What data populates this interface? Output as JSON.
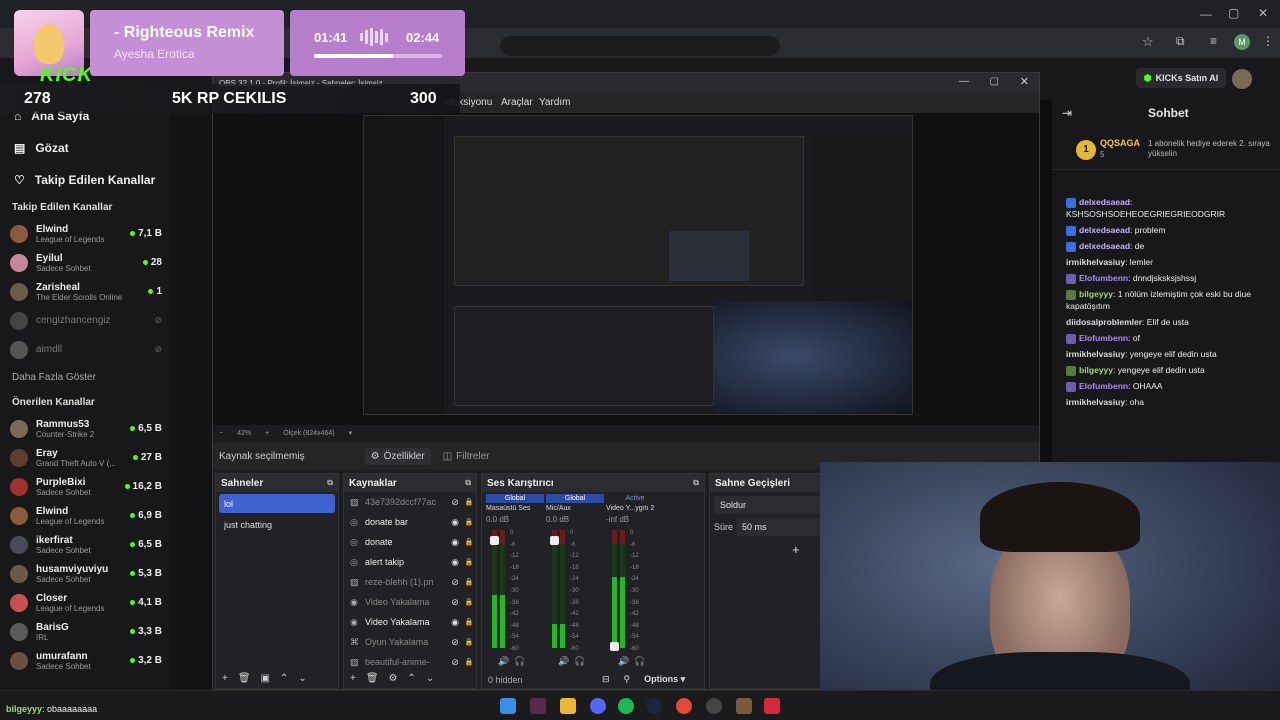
{
  "overlay": {
    "song_title": "- Righteous Remix",
    "artist": "Ayesha Erotica",
    "time_current": "01:41",
    "time_total": "02:44",
    "kick_logo": "KICK",
    "stats": {
      "left_num": "278",
      "center": "5K RP CEKILIS",
      "right_num": "300"
    }
  },
  "browser": {
    "kick_button": "KICKs Satın Al"
  },
  "sidebar": {
    "nav": [
      {
        "label": "Ana Sayfa",
        "icon": "home-icon"
      },
      {
        "label": "Gözat",
        "icon": "browse-icon"
      },
      {
        "label": "Takip Edilen Kanallar",
        "icon": "heart-icon"
      }
    ],
    "followed_heading": "Takip Edilen Kanallar",
    "followed": [
      {
        "name": "Elwind",
        "category": "League of Legends",
        "viewers": "7,1 B",
        "color": "#8a5a3c"
      },
      {
        "name": "Eyilul",
        "category": "Sadece Sohbet",
        "viewers": "28",
        "color": "#c4889a"
      },
      {
        "name": "Zarisheal",
        "category": "The Elder Scrolls Online",
        "viewers": "1",
        "color": "#6b5b4b"
      },
      {
        "name": "cengizhancengiz",
        "category": "",
        "viewers": "",
        "color": "#444",
        "offline": true
      },
      {
        "name": "aimdll",
        "category": "",
        "viewers": "",
        "color": "#555",
        "offline": true
      }
    ],
    "show_more": "Daha Fazla Göster",
    "recommended_heading": "Önerilen Kanallar",
    "recommended": [
      {
        "name": "Rammus53",
        "category": "Counter-Strike 2",
        "viewers": "6,5 B",
        "color": "#7a6a5a"
      },
      {
        "name": "Eray",
        "category": "Grand Theft Auto V (...",
        "viewers": "27 B",
        "color": "#5a4030"
      },
      {
        "name": "PurpleBixi",
        "category": "Sadece Sohbet",
        "viewers": "16,2 B",
        "color": "#a13030"
      },
      {
        "name": "Elwind",
        "category": "League of Legends",
        "viewers": "6,9 B",
        "color": "#8a5a3c"
      },
      {
        "name": "ikerfirat",
        "category": "Sadece Sohbet",
        "viewers": "6,5 B",
        "color": "#4a4a55"
      },
      {
        "name": "husamviyuviyu",
        "category": "Sadece Sohbet",
        "viewers": "5,3 B",
        "color": "#6a5a4a"
      },
      {
        "name": "Closer",
        "category": "League of Legends",
        "viewers": "4,1 B",
        "color": "#c95050"
      },
      {
        "name": "BarisG",
        "category": "IRL",
        "viewers": "3,3 B",
        "color": "#5a5a5a"
      },
      {
        "name": "umurafann",
        "category": "Sadece Sohbet",
        "viewers": "3,2 B",
        "color": "#6a5040"
      }
    ],
    "bottom_chat_user": "bilgeyyy",
    "bottom_chat_text": ": obaaaaaaaa"
  },
  "obs": {
    "title": "OBS 32.1.0 - Profil: İsimsiz - Sahneler: İsimsiz",
    "menu": [
      "oleksiyonu",
      "Araçlar",
      "Yardım"
    ],
    "zoom": "42%",
    "canvas": "Ölçek (824x464)",
    "no_source": "Kaynak seçilmemiş",
    "properties": "Özellikler",
    "filters": "Filtreler",
    "scenes_title": "Sahneler",
    "scenes": [
      "lol",
      "just chatting"
    ],
    "sources_title": "Kaynaklar",
    "sources": [
      {
        "label": "43e7392dccf77ac",
        "icon": "image-icon",
        "dim": true
      },
      {
        "label": "donate bar",
        "icon": "browser-icon",
        "dim": false
      },
      {
        "label": "donate",
        "icon": "browser-icon",
        "dim": false
      },
      {
        "label": "alert takip",
        "icon": "browser-icon",
        "dim": false
      },
      {
        "label": "reze-blehh (1).pn",
        "icon": "image-icon",
        "dim": true
      },
      {
        "label": "Video Yakalama",
        "icon": "camera-icon",
        "dim": true
      },
      {
        "label": "Video Yakalama",
        "icon": "camera-icon",
        "dim": false
      },
      {
        "label": "Oyun Yakalama",
        "icon": "gamepad-icon",
        "dim": true
      },
      {
        "label": "beautiful-anime-",
        "icon": "image-icon",
        "dim": true
      }
    ],
    "mixer_title": "Ses Karıştırıcı",
    "mixer": [
      {
        "tag": "Global",
        "name": "Masaüstü Ses",
        "db": "0.0 dB"
      },
      {
        "tag": "Global",
        "name": "Mic/Aux",
        "db": "0.0 dB"
      },
      {
        "tag": "Active",
        "name": "Video Y...ygıtı 2",
        "db": "-inf dB"
      }
    ],
    "scale": [
      "0",
      "-6",
      "-12",
      "-18",
      "-24",
      "-30",
      "-36",
      "-42",
      "-48",
      "-54",
      "-60"
    ],
    "hidden": "0 hidden",
    "options": "Options",
    "transitions_title": "Sahne Geçişleri",
    "transition": "Soldur",
    "duration_label": "Süre",
    "duration": "50 ms"
  },
  "chat": {
    "title": "Sohbet",
    "pinned_user": "QQSAGA",
    "pinned_count": "5",
    "pinned_text": "1 abonelik hediye ederek 2. sıraya yükselin",
    "messages": [
      {
        "user": "delxedsaead",
        "text": "KSHSOSHSOEHEOEGRIEGRIEODGRIR",
        "color": "#c9b3ff",
        "badge": "#3b6fe0"
      },
      {
        "user": "delxedsaead",
        "text": "problem",
        "color": "#c9b3ff",
        "badge": "#3b6fe0"
      },
      {
        "user": "delxedsaead",
        "text": "de",
        "color": "#c9b3ff",
        "badge": "#3b6fe0"
      },
      {
        "user": "irmikhelvasiuy",
        "text": "lemler",
        "color": "#dddddd",
        "badge": ""
      },
      {
        "user": "Elofumbenn",
        "text": "dnndjsksksjshssj",
        "color": "#a78bfa",
        "badge": "#6b5fb0"
      },
      {
        "user": "bilgeyyy",
        "text": "1 nölüm izlemiştim çok eski bu diue kapatöşıtım",
        "color": "#9ddc6a",
        "badge": "#5a7a3a"
      },
      {
        "user": "diidosalproblemler",
        "text": "Elif de usta",
        "color": "#dddddd",
        "badge": ""
      },
      {
        "user": "Elofumbenn",
        "text": "of",
        "color": "#a78bfa",
        "badge": "#6b5fb0"
      },
      {
        "user": "irmikhelvasiuy",
        "text": "yengeye elif dedin usta",
        "color": "#dddddd",
        "badge": ""
      },
      {
        "user": "bilgeyyy",
        "text": "yengeye elif dedin usta",
        "color": "#9ddc6a",
        "badge": "#5a7a3a"
      },
      {
        "user": "Elofumbenn",
        "text": "OHAAA",
        "color": "#a78bfa",
        "badge": "#6b5fb0"
      },
      {
        "user": "irmikhelvasiuy",
        "text": "oha",
        "color": "#dddddd",
        "badge": ""
      }
    ]
  },
  "colors": {
    "kick_green": "#53fc18",
    "obs_select": "#3f62d0",
    "meter_green": "#27b827"
  }
}
